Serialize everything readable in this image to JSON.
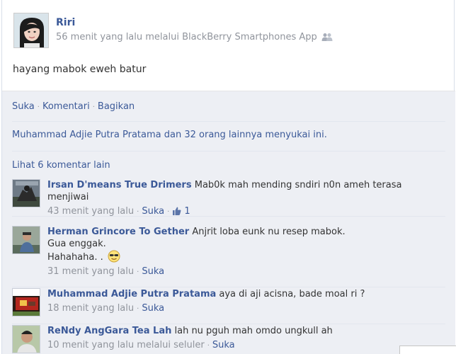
{
  "post": {
    "author": "Riri",
    "meta": "56 menit yang lalu melalui BlackBerry Smartphones App",
    "people_icon": "people-icon",
    "status": "hayang mabok eweh batur"
  },
  "actions": {
    "like": "Suka",
    "comment": "Komentari",
    "share": "Bagikan"
  },
  "likes": {
    "first": "Muhammad Adjie Putra Pratama",
    "middle": " dan ",
    "others": "32 orang lainnya",
    "suffix": " menyukai ini."
  },
  "more_comments": "Lihat 6 komentar lain",
  "comments": [
    {
      "name": "Irsan D'means True Drimers",
      "text": " Mab0k mah mending sndiri n0n ameh terasa menjiwai",
      "time": "43 menit yang lalu",
      "like": "Suka",
      "like_count": "1"
    },
    {
      "name": "Herman Grincore To Gether",
      "text": " Anjrit loba eunk nu resep mabok.",
      "line2": "Gua enggak.",
      "line3": "Hahahaha. . ",
      "time": "31 menit yang lalu",
      "like": "Suka"
    },
    {
      "name": "Muhammad Adjie Putra Pratama",
      "text": " aya di aji acisna, bade moal ri ?",
      "time": "18 menit yang lalu",
      "like": "Suka"
    },
    {
      "name": "ReNdy AngGara Tea Lah",
      "text": " lah nu pguh mah omdo ungkull ah",
      "time": "10 menit yang lalu melalui seluler",
      "like": "Suka"
    }
  ],
  "colors": {
    "link": "#3b5998",
    "meta": "#90949c",
    "feedback_bg": "#edeff4"
  }
}
